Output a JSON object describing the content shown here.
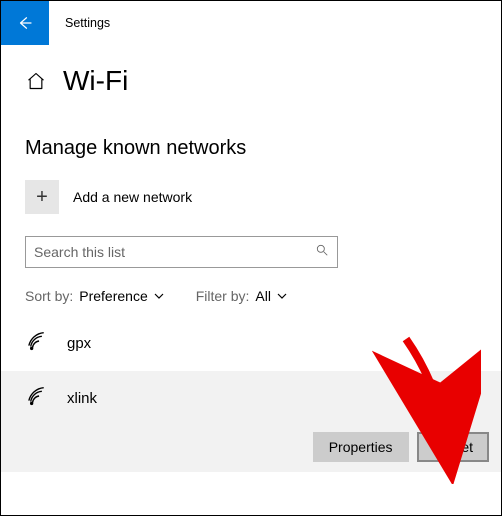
{
  "titlebar": {
    "title": "Settings"
  },
  "header": {
    "page_title": "Wi-Fi"
  },
  "subheading": "Manage known networks",
  "add_network": {
    "label": "Add a new network"
  },
  "search": {
    "placeholder": "Search this list"
  },
  "sort": {
    "label": "Sort by:",
    "value": "Preference"
  },
  "filter": {
    "label": "Filter by:",
    "value": "All"
  },
  "networks": [
    {
      "name": "gpx",
      "selected": false
    },
    {
      "name": "xlink",
      "selected": true
    }
  ],
  "actions": {
    "properties": "Properties",
    "forget": "Forget"
  }
}
